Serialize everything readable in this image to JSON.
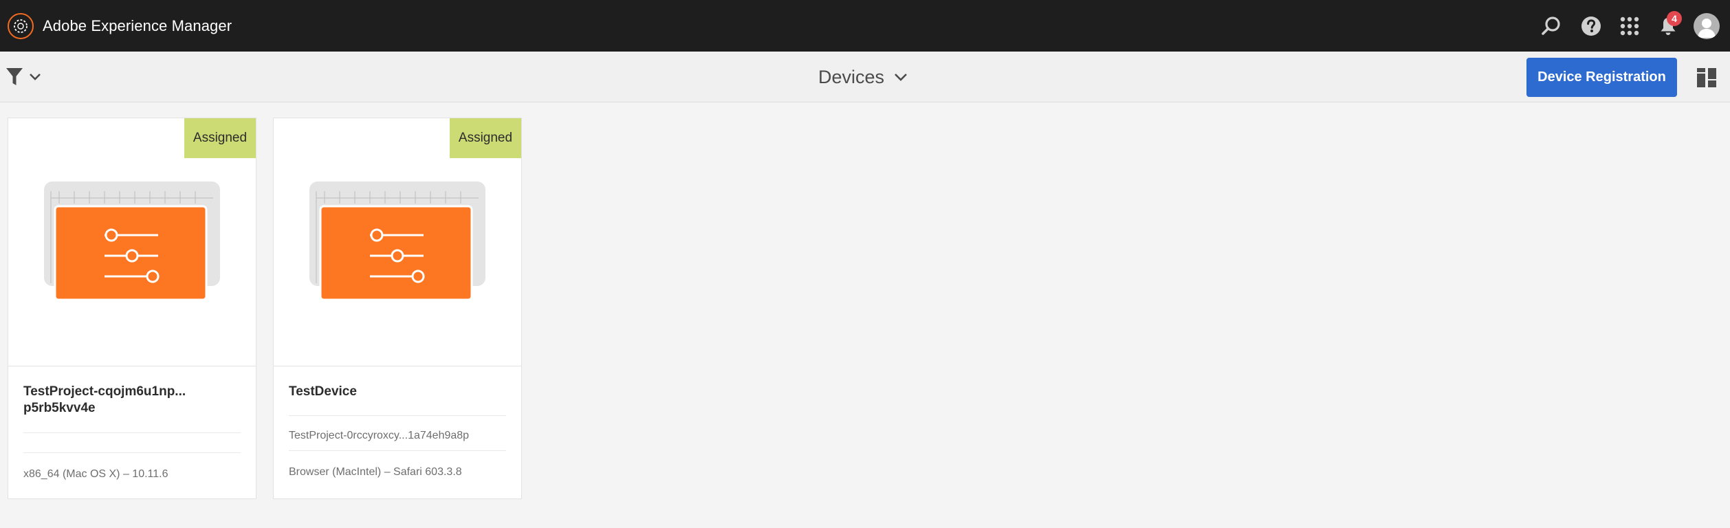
{
  "app": {
    "title": "Adobe Experience Manager",
    "logo_icon": "aem-logo-icon",
    "notification_count": "4"
  },
  "header_actions": {
    "search_icon": "search-icon",
    "help_icon": "help-icon",
    "solutions_icon": "grid-apps-icon",
    "notifications_icon": "bell-icon",
    "profile_icon": "user-avatar-icon"
  },
  "action_bar": {
    "filter_icon": "filter-icon",
    "title": "Devices",
    "primary_action": "Device Registration",
    "view_icon": "card-view-icon"
  },
  "colors": {
    "header_bg": "#1e1e1e",
    "primary_button": "#2d6bd0",
    "assigned_tag": "#ccdb74",
    "device_orange": "#fd7722",
    "notification_badge": "#e34850"
  },
  "cards": [
    {
      "status": "Assigned",
      "title_line1": "TestProject-cqojm6u1np...",
      "title_line2": "p5rb5kvv4e",
      "project": "",
      "platform": "x86_64 (Mac OS X) – 10.11.6"
    },
    {
      "status": "Assigned",
      "title_line1": "TestDevice",
      "title_line2": "",
      "project": "TestProject-0rccyroxcy...1a74eh9a8p",
      "platform": "Browser (MacIntel) – Safari 603.3.8"
    }
  ]
}
